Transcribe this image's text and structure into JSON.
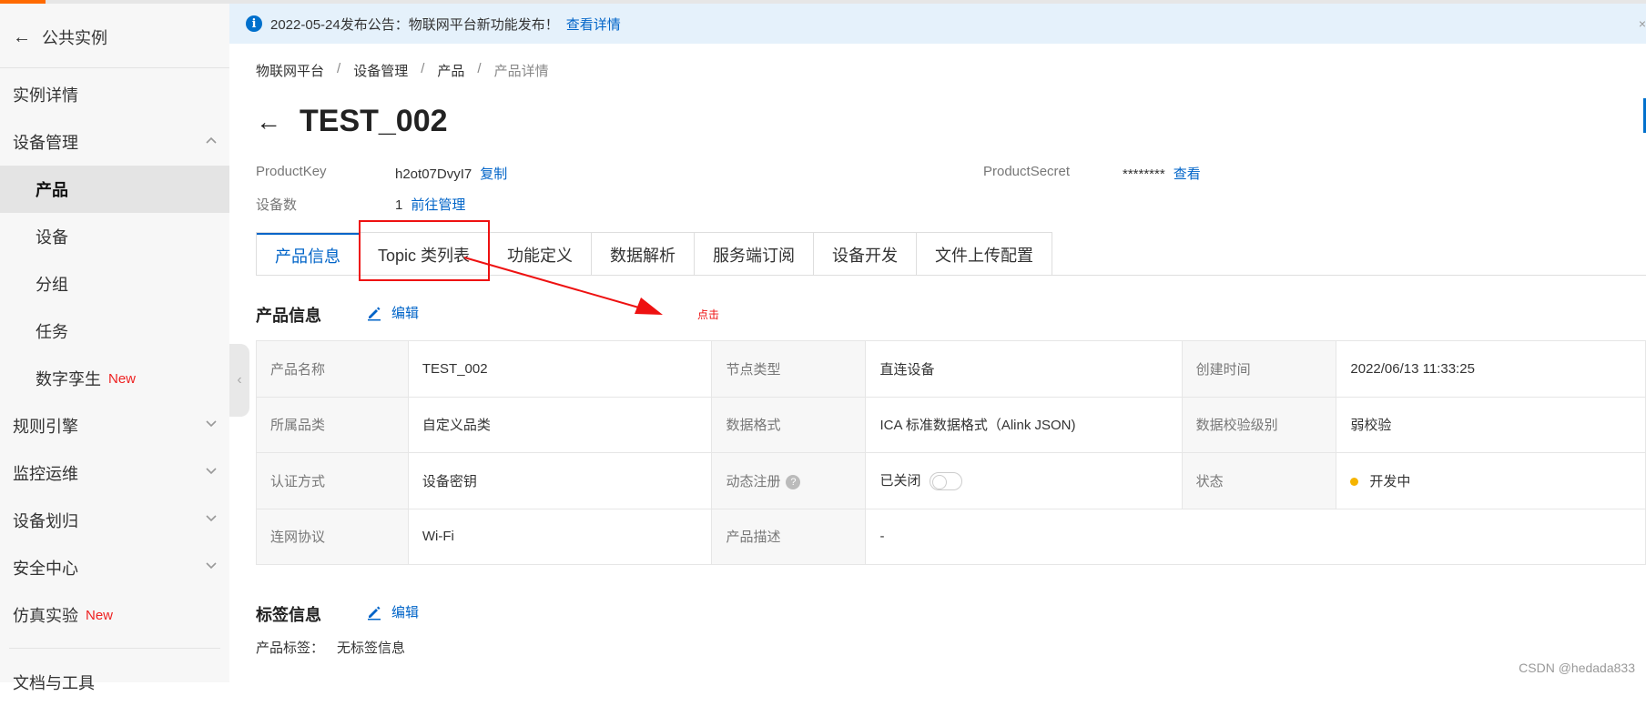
{
  "sidebar": {
    "back_label": "公共实例",
    "items": [
      {
        "label": "实例详情"
      },
      {
        "label": "设备管理"
      },
      {
        "label": "产品"
      },
      {
        "label": "设备"
      },
      {
        "label": "分组"
      },
      {
        "label": "任务"
      },
      {
        "label": "数字孪生",
        "badge": "New"
      },
      {
        "label": "规则引擎"
      },
      {
        "label": "监控运维"
      },
      {
        "label": "设备划归"
      },
      {
        "label": "安全中心"
      },
      {
        "label": "仿真实验",
        "badge": "New"
      },
      {
        "label": "文档与工具"
      }
    ]
  },
  "notice": {
    "text": "2022-05-24发布公告：物联网平台新功能发布！",
    "link": "查看详情"
  },
  "breadcrumb": [
    "物联网平台",
    "设备管理",
    "产品",
    "产品详情"
  ],
  "breadcrumb_sep": "/",
  "page_title": "TEST_002",
  "overview": {
    "product_key_label": "ProductKey",
    "product_key_value": "h2ot07DvyI7",
    "copy_link": "复制",
    "product_secret_label": "ProductSecret",
    "product_secret_value": "********",
    "view_link": "查看",
    "device_count_label": "设备数",
    "device_count_value": "1",
    "manage_link": "前往管理"
  },
  "tabs": [
    "产品信息",
    "Topic 类列表",
    "功能定义",
    "数据解析",
    "服务端订阅",
    "设备开发",
    "文件上传配置"
  ],
  "product_info": {
    "title": "产品信息",
    "edit": "编辑",
    "rows": [
      [
        {
          "label": "产品名称",
          "value": "TEST_002"
        },
        {
          "label": "节点类型",
          "value": "直连设备"
        },
        {
          "label": "创建时间",
          "value": "2022/06/13 11:33:25"
        }
      ],
      [
        {
          "label": "所属品类",
          "value": "自定义品类"
        },
        {
          "label": "数据格式",
          "value": "ICA 标准数据格式（Alink JSON)"
        },
        {
          "label": "数据校验级别",
          "value": "弱校验"
        }
      ],
      [
        {
          "label": "认证方式",
          "value": "设备密钥"
        },
        {
          "label": "动态注册",
          "value": "已关闭"
        },
        {
          "label": "状态",
          "value": "开发中"
        }
      ],
      [
        {
          "label": "连网协议",
          "value": "Wi-Fi"
        },
        {
          "label": "产品描述",
          "value": "-"
        }
      ]
    ],
    "help_glyph": "?",
    "dynamic_register_enabled": false,
    "status_color": "#f5b400"
  },
  "tag_info": {
    "title": "标签信息",
    "edit": "编辑",
    "label": "产品标签：",
    "value": "无标签信息"
  },
  "annotation": {
    "text": "点击",
    "color": "#e11"
  },
  "watermark": "CSDN @hedada833",
  "colors": {
    "accent": "#0064c8",
    "brand_orange": "#ff6a00",
    "notice_bg": "#e5f1fb"
  }
}
